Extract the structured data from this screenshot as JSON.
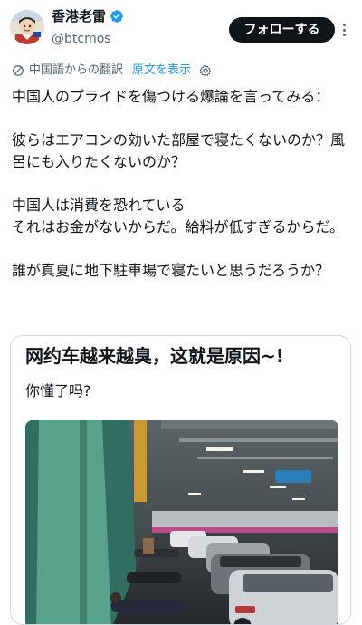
{
  "author": {
    "display_name": "香港老雷",
    "handle": "@btcmos",
    "verified": true,
    "avatar_icon": "avatar-illustration"
  },
  "header": {
    "follow_label": "フォローする",
    "more_icon": "more-dots-icon"
  },
  "translation": {
    "status": "中国語からの翻訳",
    "show_original": "原文を表示",
    "accent_color": "#1d9bf0"
  },
  "tweet": {
    "paragraphs": [
      "中国人のプライドを傷つける爆論を言ってみる：",
      "彼らはエアコンの効いた部屋で寝たくないのか？風呂にも入りたくないのか？",
      "中国人は消費を恐れている\nそれはお金がないからだ。給料が低すぎるからだ。",
      "誰が真夏に地下駐車場で寝たいと思うだろうか？"
    ]
  },
  "quote": {
    "title": "网约车越来越臭，这就是原因~!",
    "subtitle": "你懂了吗?"
  },
  "colors": {
    "text": "#0f1419",
    "secondary": "#536471",
    "link": "#1d9bf0",
    "button_bg": "#0f1419"
  }
}
